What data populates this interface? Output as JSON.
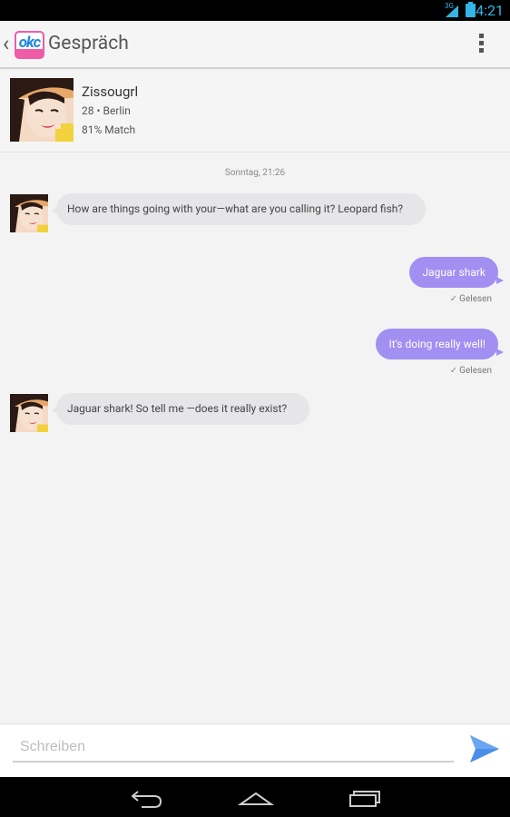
{
  "status_bar": {
    "network": "3G",
    "time": "4:21"
  },
  "action_bar": {
    "logo_text": "okc",
    "title": "Gespräch"
  },
  "profile": {
    "name": "Zissougrl",
    "meta": "28 • Berlin",
    "match": "81% Match"
  },
  "conversation": {
    "timestamp": "Sonntag, 21:26",
    "messages": [
      {
        "direction": "in",
        "text": "How are things going with your—what are you calling it? Leopard fish?"
      },
      {
        "direction": "out",
        "text": "Jaguar shark",
        "status": "Gelesen"
      },
      {
        "direction": "out",
        "text": "It's doing really well!",
        "status": "Gelesen"
      },
      {
        "direction": "in",
        "text": "Jaguar shark! So tell me —does it really exist?"
      }
    ]
  },
  "composer": {
    "placeholder": "Schreiben"
  },
  "colors": {
    "accent_out_bubble": "#a18ff2",
    "in_bubble": "#e6e6e9",
    "send_icon": "#4a8fe8",
    "logo_pink": "#ef5ca8",
    "logo_blue": "#1e88e5"
  },
  "icons": {
    "back": "chevron-left-icon",
    "menu": "overflow-menu-icon",
    "send": "send-icon",
    "read": "check-icon",
    "nav_back": "nav-back-icon",
    "nav_home": "nav-home-icon",
    "nav_recents": "nav-recents-icon"
  }
}
